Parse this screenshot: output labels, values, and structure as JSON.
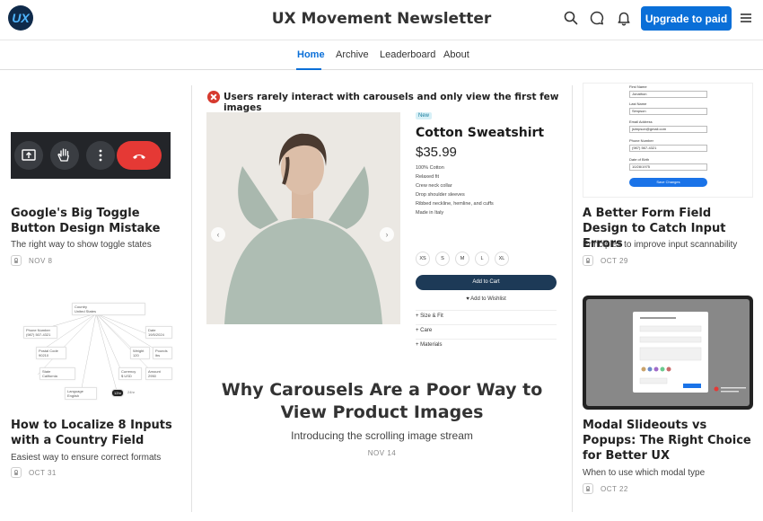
{
  "header": {
    "logo_text": "UX",
    "title": "UX Movement Newsletter",
    "upgrade_label": "Upgrade to paid",
    "icons": [
      "search-icon",
      "chat-icon",
      "bell-icon",
      "menu-icon"
    ]
  },
  "nav": {
    "tabs": [
      {
        "label": "Home",
        "active": true
      },
      {
        "label": "Archive",
        "active": false
      },
      {
        "label": "Leaderboard",
        "active": false
      },
      {
        "label": "About",
        "active": false
      }
    ]
  },
  "left": {
    "posts": [
      {
        "title": "Google's Big Toggle Button Design Mistake",
        "subtitle": "The right way to show toggle states",
        "date": "NOV 8"
      },
      {
        "title": "How to Localize 8 Inputs with a Country Field",
        "subtitle": "Easiest way to ensure correct formats",
        "date": "OCT 31"
      }
    ],
    "diagram": {
      "country_label": "Country",
      "country_value": "United States",
      "phone_label": "Phone Number",
      "phone_value": "(987) 507-4321",
      "date_label": "Date",
      "date_value": "19/5/2024",
      "postal_label": "Postal Code",
      "postal_value": "90210",
      "weight_label": "Weight",
      "weight_value": "120",
      "pounds_label": "Pounds",
      "pounds_value": "lbs",
      "state_label": "State",
      "state_value": "California",
      "currency_label": "Currency",
      "currency_value": "$ USD",
      "amount_label": "Amount",
      "amount_value": "2950",
      "language_label": "Language",
      "language_value": "English",
      "time_24": "12hr",
      "time_12": "24hr"
    }
  },
  "center": {
    "note": "Users rarely interact with carousels and only view the first few images",
    "product": {
      "badge": "New",
      "name": "Cotton Sweatshirt",
      "price": "$35.99",
      "features": [
        "100% Cotton",
        "Relaxed fit",
        "Crew neck collar",
        "Drop shoulder sleeves",
        "Ribbed neckline, hemline, and cuffs",
        "Made in Italy"
      ],
      "sizes": [
        "XS",
        "S",
        "M",
        "L",
        "XL"
      ],
      "cart_label": "Add to Cart",
      "wishlist_label": "Add to Wishlist",
      "sections": [
        "Size & Fit",
        "Care",
        "Materials"
      ]
    },
    "title": "Why Carousels Are a Poor Way to View Product Images",
    "subtitle": "Introducing the scrolling image stream",
    "date": "NOV 14"
  },
  "right": {
    "form": {
      "first_name_label": "First Name",
      "first_name_value": "Jonathon",
      "last_name_label": "Last Name",
      "last_name_value": "Simpson",
      "email_label": "Email Address",
      "email_value": "jsimpson@gmail.com",
      "phone_label": "Phone Number",
      "phone_value": "(987) 567-4321",
      "dob_label": "Date of Birth",
      "dob_value": "10/28/1975",
      "save_label": "Save Changes"
    },
    "posts": [
      {
        "title": "A Better Form Field Design to Catch Input Errors",
        "subtitle": "Principles to improve input scannability",
        "date": "OCT 29"
      },
      {
        "title": "Modal Slideouts vs Popups: The Right Choice for Better UX",
        "subtitle": "When to use which modal type",
        "date": "OCT 22"
      }
    ]
  },
  "colors": {
    "accent": "#0a6fd8",
    "error": "#d63a2e",
    "cart": "#1d3a57"
  }
}
